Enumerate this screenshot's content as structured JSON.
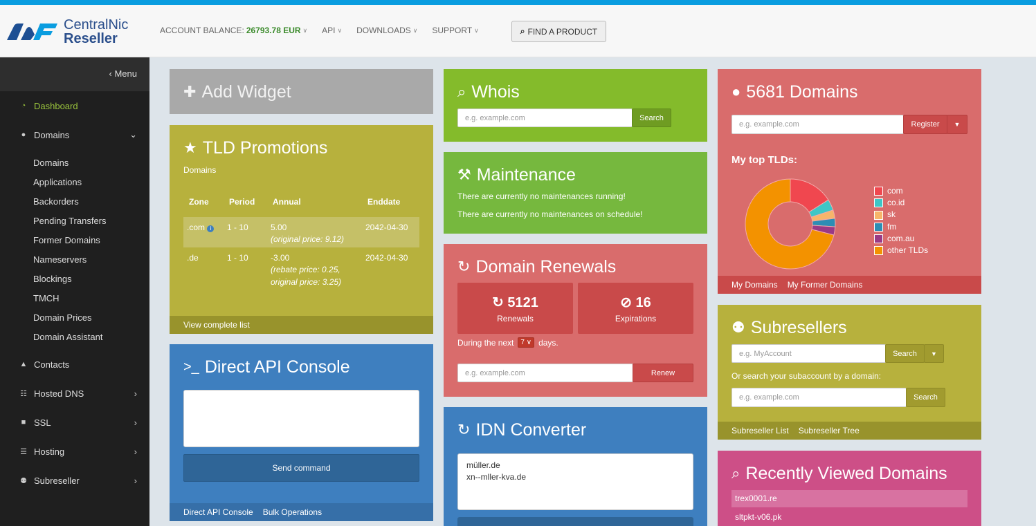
{
  "colors": {
    "blue": "#3e7fbf",
    "gray": "#a9a9a9",
    "olive": "#b7b13d",
    "green": "#84bb2b",
    "green2": "#76b83e",
    "red": "#d96c6c",
    "pink": "#cd4f87"
  },
  "header": {
    "logo_line1": "CentralNic",
    "logo_line2": "Reseller",
    "balance_label": "ACCOUNT BALANCE:",
    "balance_value": "26793.78 EUR",
    "nav_api": "API",
    "nav_downloads": "DOWNLOADS",
    "nav_support": "SUPPORT",
    "find_product": "FIND A PRODUCT"
  },
  "sidebar": {
    "menu_label": "Menu",
    "dashboard": "Dashboard",
    "domains": "Domains",
    "domain_items": [
      "Domains",
      "Applications",
      "Backorders",
      "Pending Transfers",
      "Former Domains",
      "Nameservers",
      "Blockings",
      "TMCH",
      "Domain Prices",
      "Domain Assistant"
    ],
    "contacts": "Contacts",
    "hosted_dns": "Hosted DNS",
    "ssl": "SSL",
    "hosting": "Hosting",
    "subreseller": "Subreseller"
  },
  "add_widget": {
    "title": "Add Widget"
  },
  "tld_promotions": {
    "title": "TLD Promotions",
    "subtitle": "Domains",
    "headers": [
      "Zone",
      "Period",
      "Annual",
      "Enddate"
    ],
    "rows": [
      {
        "zone": ".com",
        "period": "1 - 10",
        "annual": "5.00",
        "note1": "(original price: 9.12)",
        "note2": "",
        "enddate": "2042-04-30"
      },
      {
        "zone": ".de",
        "period": "1 - 10",
        "annual": "-3.00",
        "note1": "(rebate price: 0.25,",
        "note2": "original price: 3.25)",
        "enddate": "2042-04-30"
      }
    ],
    "footer": "View complete list"
  },
  "api_console": {
    "title": "Direct API Console",
    "send": "Send command",
    "footer1": "Direct API Console",
    "footer2": "Bulk Operations"
  },
  "whois": {
    "title": "Whois",
    "placeholder": "e.g. example.com",
    "search": "Search"
  },
  "maintenance": {
    "title": "Maintenance",
    "line1": "There are currently no maintenances running!",
    "line2": "There are currently no maintenances on schedule!"
  },
  "renewals": {
    "title": "Domain Renewals",
    "renew_count": "5121",
    "renew_label": "Renewals",
    "exp_count": "16",
    "exp_label": "Expirations",
    "during_prefix": "During the next",
    "days_value": "7",
    "during_suffix": "days.",
    "placeholder": "e.g. example.com",
    "renew_btn": "Renew"
  },
  "idn": {
    "title": "IDN Converter",
    "text": "müller.de\nxn--mller-kva.de"
  },
  "domains_widget": {
    "title": "5681 Domains",
    "placeholder": "e.g. example.com",
    "register": "Register",
    "top_tlds": "My top TLDs:",
    "footer1": "My Domains",
    "footer2": "My Former Domains"
  },
  "chart_data": {
    "type": "pie",
    "categories": [
      "com",
      "co.id",
      "sk",
      "fm",
      "com.au",
      "other TLDs"
    ],
    "values": [
      16,
      4,
      3,
      3,
      3,
      71
    ],
    "colors": [
      "#f0474f",
      "#3ec6c6",
      "#f7b56a",
      "#2d8db4",
      "#9a3a85",
      "#f39200"
    ]
  },
  "subresellers": {
    "title": "Subresellers",
    "placeholder": "e.g. MyAccount",
    "search": "Search",
    "or_text": "Or search your subaccount by a domain:",
    "placeholder2": "e.g. example.com",
    "search2": "Search",
    "footer1": "Subreseller List",
    "footer2": "Subreseller Tree"
  },
  "recent": {
    "title": "Recently Viewed Domains",
    "items": [
      "trex0001.re",
      "sltpkt-v06.pk"
    ]
  }
}
